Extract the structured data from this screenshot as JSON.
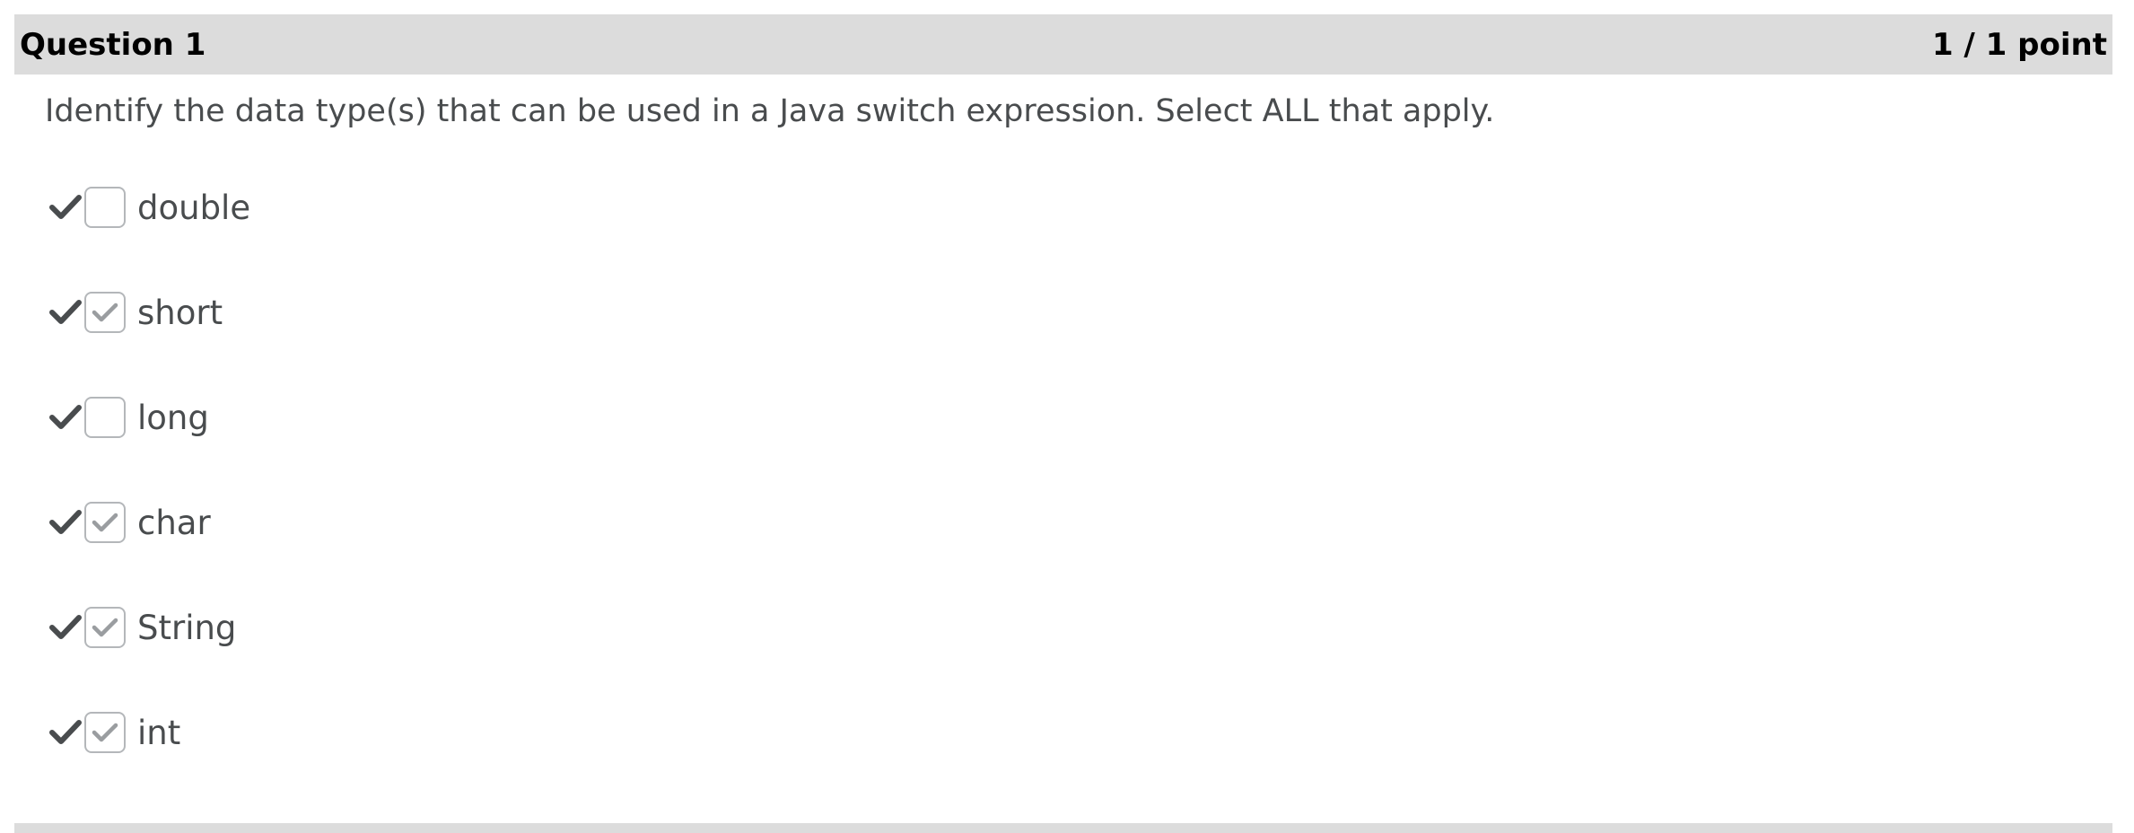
{
  "question": {
    "title": "Question 1",
    "score": "1 / 1 point",
    "prompt": "Identify the data type(s) that can be used in a Java switch expression. Select ALL that apply."
  },
  "options": [
    {
      "label": "double",
      "checked": false,
      "feedback_icon": "check-icon"
    },
    {
      "label": "short",
      "checked": true,
      "feedback_icon": "check-icon"
    },
    {
      "label": "long",
      "checked": false,
      "feedback_icon": "check-icon"
    },
    {
      "label": "char",
      "checked": true,
      "feedback_icon": "check-icon"
    },
    {
      "label": "String",
      "checked": true,
      "feedback_icon": "check-icon"
    },
    {
      "label": "int",
      "checked": true,
      "feedback_icon": "check-icon"
    }
  ],
  "colors": {
    "header_bg": "#dcdcdc",
    "text": "#494c4e",
    "feedback_check": "#494c4e",
    "checkbox_mark": "#9a9da0",
    "checkbox_border": "#b4b7ba"
  }
}
